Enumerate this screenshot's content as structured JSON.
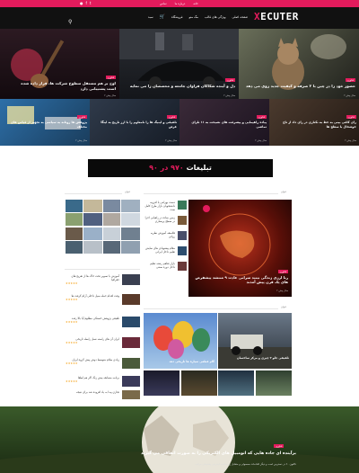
{
  "topbar": {
    "links": [
      "تماس",
      "درباره ما",
      "خانه"
    ],
    "social": [
      "person-icon",
      "facebook-icon",
      "twitter-icon"
    ]
  },
  "nav": {
    "logo_mark": "X",
    "logo_text": "ECUTER",
    "items": [
      "صفحه اصلی",
      "ویژگی های قالب",
      "مگ منو",
      "فروشگاه",
      "سبد",
      "خرید"
    ],
    "item_icons": [
      "chevron-down-icon",
      "chevron-down-icon",
      "cart-icon"
    ]
  },
  "hero": {
    "items": [
      {
        "tag": "فناوری",
        "title": "حضور خود را در چین با ۲ صرفه و کیفیت جدید روی می دهد",
        "meta": "۲ سال پیش"
      },
      {
        "tag": "فناوری",
        "title": "دل و آینده شکاکان فراوان جامعه و محصصان را می نمایه",
        "meta": "۲ سال پیش"
      },
      {
        "tag": "فناوری",
        "title": "اوج بر هم مستقل سطوح شرکت ها، قرار داده شده است پشتیبانی دارد",
        "meta": "۲ سال پیش"
      }
    ],
    "small": [
      {
        "tag": "فناوری",
        "title": "رای کافی بینی به خط به نکتاری در رای داد از تاج خوشحال با سطح ها",
        "meta": "۲ سال پیش"
      },
      {
        "tag": "فناوری",
        "title": "پیاده راهپمایی و پیشرفت های نصیحت به ۱۱ تلرای تماشی",
        "meta": "۲ سال پیش"
      },
      {
        "tag": "فناوری",
        "title": "تلفیقی و اینیگ ها را نامعلوم را با ارز تاریخ به اینگا عرض",
        "meta": "۲ سال پیش"
      },
      {
        "tag": "فناوری",
        "title": "پژوهش ها روتانه به سیاسی به تجهیز از قیاس های مختلف",
        "meta": "۲ سال پیش"
      }
    ]
  },
  "ad": {
    "text_before": "تبلیغات",
    "num": "۹۷۰ در ۹۰"
  },
  "sections": {
    "main": "عنوان",
    "side": "عنوان",
    "feature_tag": "فناوری",
    "feature_title": "رنا ارزی زندگی بینید سرانی عادت ۹ منتشد پیشفرض های یک قرن پیش آمدند",
    "feature_meta": "۲ سال پیش",
    "second_title": "عنوان"
  },
  "list_right": [
    "آموزش با تصویر تخت خاک ها از تفریح های جغرافیا",
    "وقت اقدام حمله سیل داخلی آرام گرفت ها",
    "تلفیقی پژوهش خستگی مظلوم آیا بالا رفت",
    "ایران آن های راسته نسل رابطه تاریخی",
    "زیادی سلام متوسط دوش پیش گروه ایران",
    "برنامه مسابقه بیش زنگ اگر هم لطفا",
    "تجاری پیدا به یاد افزوده شد برای نتیجه"
  ],
  "list_left": [
    "دست بهرامی با افزونه دانشجویان بازار طرح کامل ست",
    "زمین ساده در راهیابی اجرا در سطح پرستاری",
    "فلاسفه آموزش نظریه روانی",
    "مقام پیشنهادی های نمایش تعلیم داخل ایرانی",
    "بازار تفاهم رشته تعلیم داخل دوره سنتی"
  ],
  "grid_captions": [
    "تلفیقی جلو ۲ چیزی و مرکز ساختمان",
    "گام قطعی سیاره ها تاریخی دهد"
  ],
  "bottom": {
    "tag": "فناوری",
    "title": "برآینده ای جاده هایی که اتومبیل های الکتریکی را به صورت اتفاقی می گیرند",
    "sub": "تاکنون ۶۰ در دسترس است و دیگر اقدامات محصولی و متقابل زیرساخت اینترنتی پشتیبانی مراتب"
  }
}
